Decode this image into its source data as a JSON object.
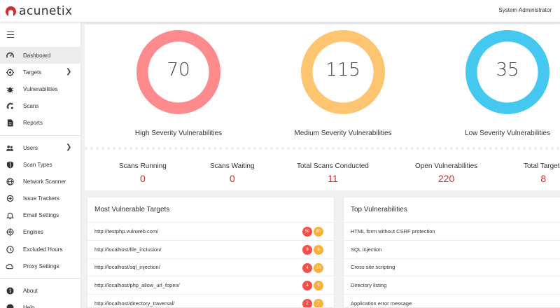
{
  "brand": {
    "name": "acunetix",
    "color": "#e3262b"
  },
  "header": {
    "user": "System Administrator"
  },
  "sidebar": {
    "items": [
      {
        "label": "Dashboard",
        "icon": "dashboard-gauge-icon",
        "active": true
      },
      {
        "label": "Targets",
        "icon": "target-icon",
        "chevron": true
      },
      {
        "label": "Vulnerabilities",
        "icon": "bug-icon"
      },
      {
        "label": "Scans",
        "icon": "radar-icon"
      },
      {
        "label": "Reports",
        "icon": "document-icon"
      },
      {
        "label": "Users",
        "icon": "users-icon",
        "chevron": true
      },
      {
        "label": "Scan Types",
        "icon": "shield-icon"
      },
      {
        "label": "Network Scanner",
        "icon": "network-icon"
      },
      {
        "label": "Issue Trackers",
        "icon": "tracker-icon"
      },
      {
        "label": "Email Settings",
        "icon": "bell-icon"
      },
      {
        "label": "Engines",
        "icon": "engine-icon"
      },
      {
        "label": "Excluded Hours",
        "icon": "clock-icon"
      },
      {
        "label": "Proxy Settings",
        "icon": "cloud-icon"
      },
      {
        "label": "About",
        "icon": "info-icon"
      },
      {
        "label": "Help",
        "icon": "help-icon"
      }
    ]
  },
  "severity": [
    {
      "count": "70",
      "label": "High Severity Vulnerabilities",
      "color": "#fd8a8d"
    },
    {
      "count": "115",
      "label": "Medium Severity Vulnerabilities",
      "color": "#fdc56f"
    },
    {
      "count": "35",
      "label": "Low Severity Vulnerabilities",
      "color": "#45c8f0"
    }
  ],
  "stats": [
    {
      "label": "Scans Running",
      "value": "0"
    },
    {
      "label": "Scans Waiting",
      "value": "0"
    },
    {
      "label": "Total Scans Conducted",
      "value": "11"
    },
    {
      "label": "Open Vulnerabilities",
      "value": "220"
    },
    {
      "label": "Total Targets",
      "value": "8"
    }
  ],
  "most_vulnerable": {
    "title": "Most Vulnerable Targets",
    "rows": [
      {
        "url": "http://testphp.vulnweb.com/",
        "high": "50",
        "medium": "60"
      },
      {
        "url": "http://localhost/file_inclusion/",
        "high": "8",
        "medium": "6"
      },
      {
        "url": "http://localhost/sql_injection/",
        "high": "4",
        "medium": "14"
      },
      {
        "url": "http://localhost/php_allow_url_fopen/",
        "high": "4",
        "medium": "6"
      },
      {
        "url": "http://localhost/directory_traversal/",
        "high": "2",
        "medium": "7"
      }
    ]
  },
  "top_vulns": {
    "title": "Top Vulnerabilities",
    "rows": [
      "HTML form without CSRF protection",
      "SQL injection",
      "Cross site scripting",
      "Directory listing",
      "Application error message"
    ]
  }
}
